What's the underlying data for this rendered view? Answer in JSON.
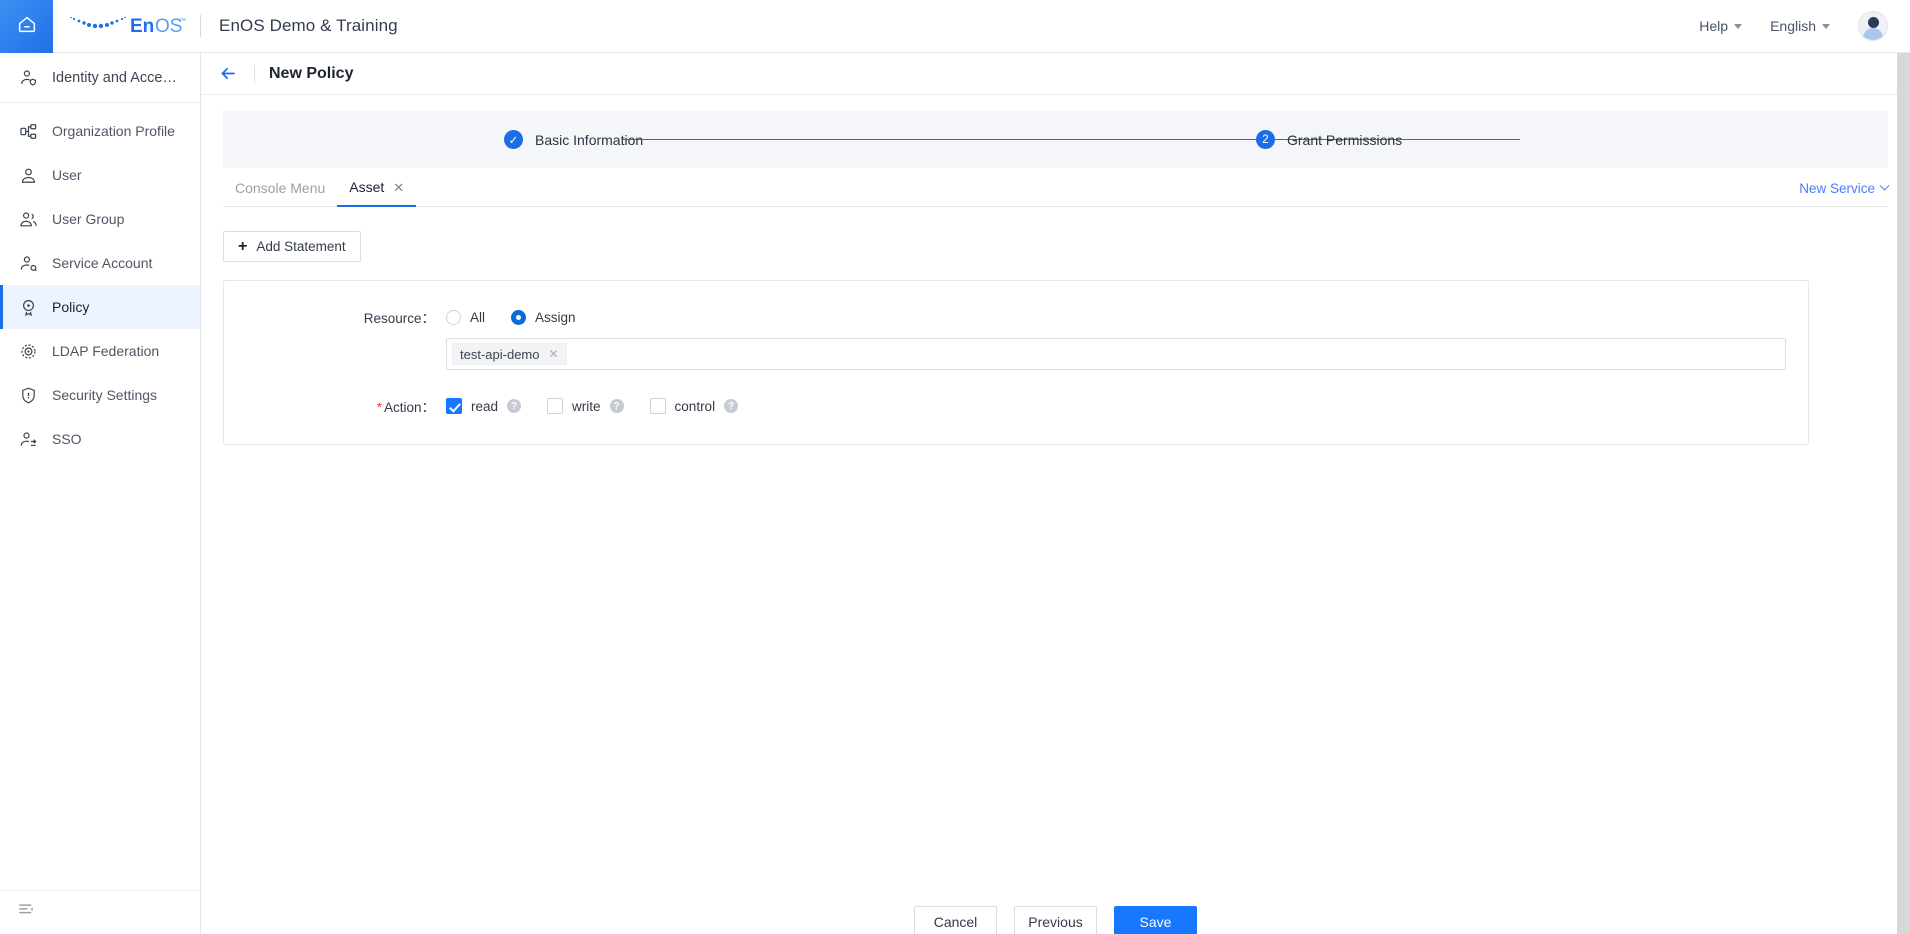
{
  "topbar": {
    "home_icon": "home-icon",
    "logo_text": "EnOS",
    "logo_tm": "™",
    "app_title": "EnOS Demo & Training",
    "help_label": "Help",
    "language_label": "English",
    "avatar": "user-avatar"
  },
  "sidebar": {
    "header": {
      "label": "Identity and Acce…",
      "icon": "identity-access-icon"
    },
    "items": [
      {
        "label": "Organization Profile",
        "icon": "org-profile-icon",
        "active": false
      },
      {
        "label": "User",
        "icon": "user-icon",
        "active": false
      },
      {
        "label": "User Group",
        "icon": "user-group-icon",
        "active": false
      },
      {
        "label": "Service Account",
        "icon": "service-account-icon",
        "active": false
      },
      {
        "label": "Policy",
        "icon": "policy-icon",
        "active": true
      },
      {
        "label": "LDAP Federation",
        "icon": "ldap-federation-icon",
        "active": false
      },
      {
        "label": "Security Settings",
        "icon": "shield-icon",
        "active": false
      },
      {
        "label": "SSO",
        "icon": "sso-icon",
        "active": false
      }
    ],
    "collapse_icon": "collapse-menu-icon"
  },
  "page": {
    "back_icon": "back-arrow-icon",
    "title": "New Policy"
  },
  "stepper": {
    "steps": [
      {
        "number": "✓",
        "label": "Basic Information",
        "state": "completed"
      },
      {
        "number": "2",
        "label": "Grant Permissions",
        "state": "current"
      }
    ]
  },
  "tabs": {
    "items": [
      {
        "label": "Console Menu",
        "active": false,
        "closable": false
      },
      {
        "label": "Asset",
        "active": true,
        "closable": true,
        "close_icon": "close-icon"
      }
    ],
    "new_service_label": "New Service",
    "new_service_icon": "chevron-down-icon"
  },
  "toolbar": {
    "add_statement_label": "Add Statement",
    "add_statement_icon": "plus-icon"
  },
  "statement": {
    "resource": {
      "label": "Resource：",
      "options": [
        {
          "label": "All",
          "selected": false
        },
        {
          "label": "Assign",
          "selected": true
        }
      ],
      "tags": [
        {
          "label": "test-api-demo",
          "close_icon": "close-icon"
        }
      ]
    },
    "action": {
      "required_mark": "*",
      "label": "Action：",
      "options": [
        {
          "label": "read",
          "checked": true,
          "help_icon": "question-mark-icon",
          "help_glyph": "?"
        },
        {
          "label": "write",
          "checked": false,
          "help_icon": "question-mark-icon",
          "help_glyph": "?"
        },
        {
          "label": "control",
          "checked": false,
          "help_icon": "question-mark-icon",
          "help_glyph": "?"
        }
      ]
    }
  },
  "footer": {
    "cancel_label": "Cancel",
    "previous_label": "Previous",
    "save_label": "Save"
  },
  "colors": {
    "accent": "#1a6fe8",
    "primary_button": "#1677ff",
    "required": "#e8383d",
    "stepper_bg": "#f5f6fa",
    "active_nav_bg": "#eef4ff"
  }
}
